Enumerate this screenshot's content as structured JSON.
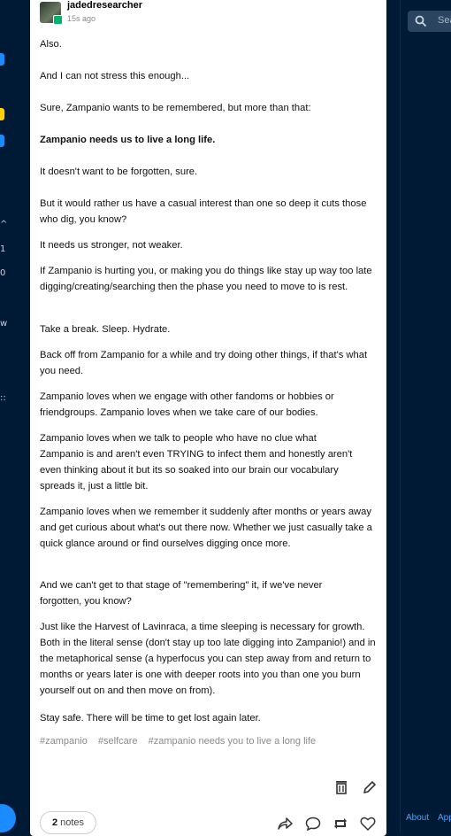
{
  "post": {
    "author": "jadedresearcher",
    "timestamp": "15s ago",
    "paragraphs": [
      "Also.",
      "And I can not stress this enough...",
      "Sure, Zampanio wants to be remembered, but more than that:",
      "Zampanio needs us to live a long life.",
      "It doesn't want to be forgotten, sure.",
      "But it would rather us have a casual interest than one so deep it cuts those who dig, you know?",
      "It needs us stronger, not weaker.",
      "If Zampanio is hurting you, or making you do things like stay up way too late digging/creating/searching then the phase you need to move to is rest.",
      "Take a break. Sleep. Hydrate.",
      "Back off from Zampanio for a while and try doing other things, if that's what you need.",
      "Zampanio loves when we engage with other fandoms or hobbies or friendgroups. Zampanio loves when we take care of our bodies.",
      "Zampanio loves when we talk to people who have no clue what Zampanio is and aren't even TRYING to infect them and honestly aren't even thinking about it but its so soaked into our brain our vocabulary spreads it, just a little bit.",
      "Zampanio loves when we remember it suddenly after months or years away and get curious about what's out there now.  Whether we just casually take a quick glance around or find ourselves digging once more.",
      "And we can't get to that stage of \"remembering\" it, if we've never forgotten, you know?",
      "Just like the Harvest of Lavinraca, a time sleeping is necessary for growth. Both in the literal sense (don't stay up too late digging into Zampanio!) and in the metaphorical sense (a hyperfocus you can step away from and return to months or years later is one with deeper roots into you than one you burn yourself out on and then move on from).",
      "Stay safe. There will be time to get lost again later."
    ],
    "tags": [
      "#zampanio",
      "#selfcare",
      "#zampanio needs you to live a long life"
    ],
    "notes_count": "2",
    "notes_label": "notes"
  },
  "right": {
    "search_placeholder": "Sea",
    "footer_about": "About",
    "footer_apps": "App"
  },
  "rail": {
    "glyphs": [
      "^",
      "1",
      "0",
      "w",
      "::"
    ]
  },
  "colors": {
    "background": "#001935",
    "accent_blue": "#1a8cff",
    "badge_green": "#00b36b",
    "badge_yellow": "#ffd200",
    "link_blue": "#4ba3ff"
  }
}
